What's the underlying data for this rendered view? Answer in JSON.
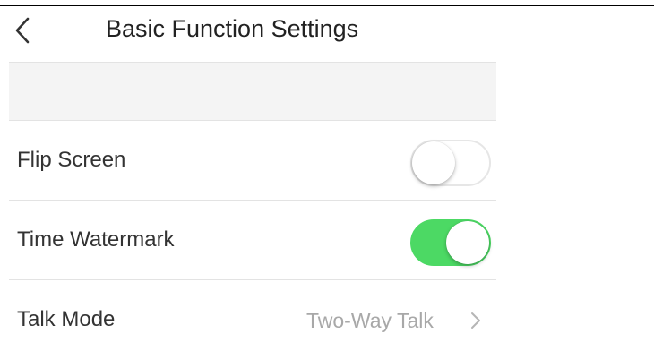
{
  "header": {
    "title": "Basic Function Settings",
    "back_icon": "chevron-left-icon"
  },
  "settings": {
    "flip_screen": {
      "label": "Flip Screen",
      "enabled": false
    },
    "time_watermark": {
      "label": "Time Watermark",
      "enabled": true
    },
    "talk_mode": {
      "label": "Talk Mode",
      "value": "Two-Way Talk",
      "icon": "chevron-right-icon"
    }
  },
  "colors": {
    "toggle_on": "#4cd964",
    "toggle_off_border": "#e6e6e6",
    "section_background": "#f4f4f4",
    "secondary_text": "#a8a8a8"
  }
}
